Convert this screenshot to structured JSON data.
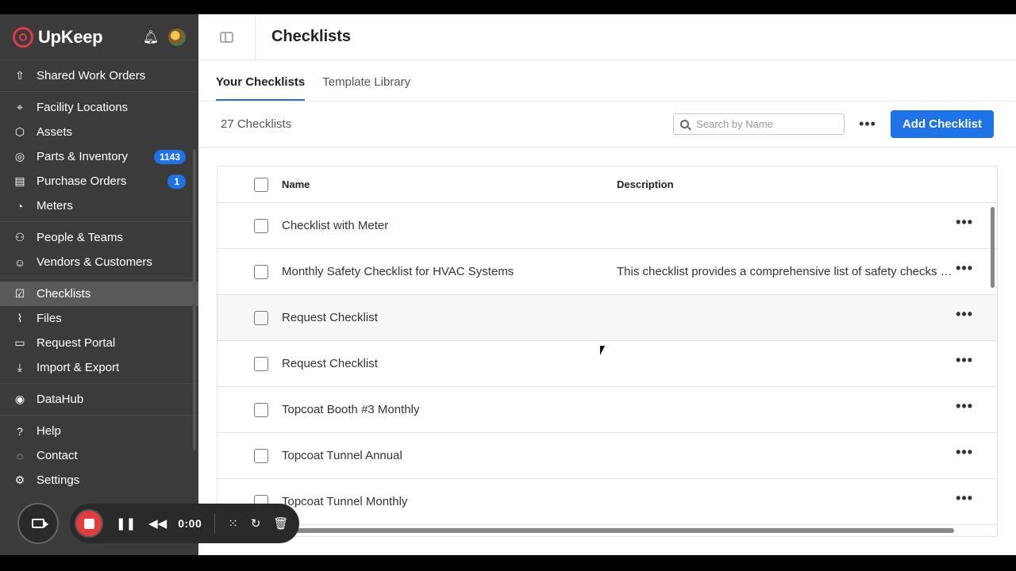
{
  "app": {
    "name": "UpKeep"
  },
  "sidebar": {
    "top_item": {
      "label": "Shared Work Orders",
      "icon": "upload-icon"
    },
    "groups": [
      [
        {
          "label": "Facility Locations",
          "icon": "location-pin-icon"
        },
        {
          "label": "Assets",
          "icon": "cube-icon"
        },
        {
          "label": "Parts & Inventory",
          "icon": "gear-part-icon",
          "badge": "1143"
        },
        {
          "label": "Purchase Orders",
          "icon": "clipboard-icon",
          "badge": "1"
        },
        {
          "label": "Meters",
          "icon": "gauge-icon"
        }
      ],
      [
        {
          "label": "People & Teams",
          "icon": "person-icon"
        },
        {
          "label": "Vendors & Customers",
          "icon": "vendor-icon"
        }
      ],
      [
        {
          "label": "Checklists",
          "icon": "checklist-icon",
          "active": true
        },
        {
          "label": "Files",
          "icon": "paperclip-icon"
        },
        {
          "label": "Request Portal",
          "icon": "inbox-icon"
        },
        {
          "label": "Import & Export",
          "icon": "download-icon"
        }
      ],
      [
        {
          "label": "DataHub",
          "icon": "datahub-icon"
        }
      ],
      [
        {
          "label": "Help",
          "icon": "help-icon"
        },
        {
          "label": "Contact",
          "icon": "chat-icon"
        },
        {
          "label": "Settings",
          "icon": "settings-icon"
        }
      ]
    ]
  },
  "header": {
    "title": "Checklists"
  },
  "tabs": [
    {
      "label": "Your Checklists",
      "active": true
    },
    {
      "label": "Template Library",
      "active": false
    }
  ],
  "toolbar": {
    "count": "27 Checklists",
    "search_placeholder": "Search by Name",
    "add_label": "Add Checklist"
  },
  "table": {
    "columns": [
      "Name",
      "Description"
    ],
    "rows": [
      {
        "name": "Checklist with Meter",
        "description": ""
      },
      {
        "name": "Monthly Safety Checklist for HVAC Systems",
        "description": "This checklist provides a comprehensive list of safety checks that…"
      },
      {
        "name": "Request Checklist",
        "description": ""
      },
      {
        "name": "Request Checklist",
        "description": ""
      },
      {
        "name": "Topcoat Booth #3 Monthly",
        "description": ""
      },
      {
        "name": "Topcoat Tunnel Annual",
        "description": ""
      },
      {
        "name": "Topcoat Tunnel Monthly",
        "description": ""
      }
    ]
  },
  "recorder": {
    "time": "0:00"
  },
  "colors": {
    "accent": "#1e73e8",
    "sidebar_bg": "#3b3b3b",
    "brand_red": "#e0394a",
    "record_red": "#e63b3b"
  }
}
